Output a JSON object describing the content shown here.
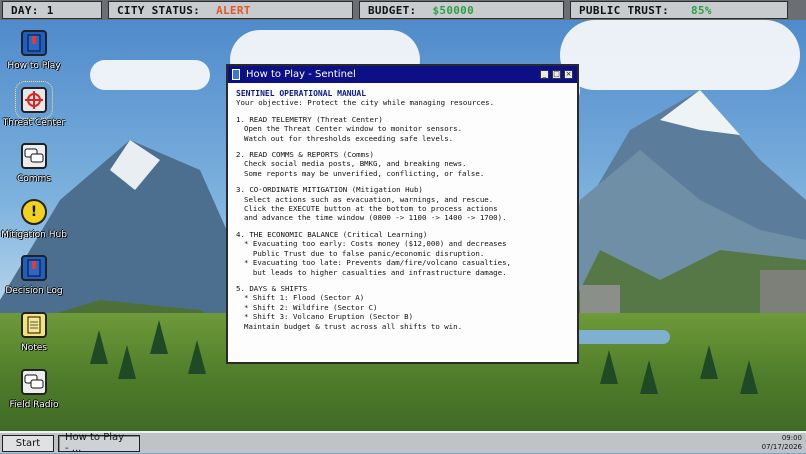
{
  "status_bar": {
    "day": {
      "label": "DAY:",
      "value": "1"
    },
    "city_status": {
      "label": "CITY STATUS:",
      "value": "ALERT"
    },
    "budget": {
      "label": "BUDGET:",
      "value": "$50000"
    },
    "public_trust": {
      "label": "PUBLIC TRUST:",
      "value": "85%"
    }
  },
  "desktop_icons": [
    {
      "label": "How to Play",
      "icon": "book-icon"
    },
    {
      "label": "Threat Center",
      "icon": "crosshair-icon"
    },
    {
      "label": "Comms",
      "icon": "chat-bubbles-icon"
    },
    {
      "label": "Mitigation Hub",
      "icon": "warning-icon"
    },
    {
      "label": "Decision Log",
      "icon": "book-icon"
    },
    {
      "label": "Notes",
      "icon": "notepad-icon"
    },
    {
      "label": "Field Radio",
      "icon": "chat-bubbles-icon"
    }
  ],
  "window": {
    "title": "How to Play - Sentinel",
    "heading": "SENTINEL OPERATIONAL MANUAL",
    "intro": "Your objective: Protect the city while managing resources.",
    "sections": [
      {
        "title": "1. READ TELEMETRY (Threat Center)",
        "lines": [
          "Open the Threat Center window to monitor sensors.",
          "Watch out for thresholds exceeding safe levels."
        ]
      },
      {
        "title": "2. READ COMMS & REPORTS (Comms)",
        "lines": [
          "Check social media posts, BMKG, and breaking news.",
          "Some reports may be unverified, conflicting, or false."
        ]
      },
      {
        "title": "3. CO-ORDINATE MITIGATION (Mitigation Hub)",
        "lines": [
          "Select actions such as evacuation, warnings, and rescue.",
          "Click the EXECUTE button at the bottom to process actions",
          "and advance the time window (0800 -> 1100 -> 1400 -> 1700)."
        ]
      },
      {
        "title": "4. THE ECONOMIC BALANCE (Critical Learning)",
        "lines": [
          "* Evacuating too early: Costs money ($12,000) and decreases",
          "  Public Trust due to false panic/economic disruption.",
          "* Evacuating too late: Prevents dam/fire/volcano casualties,",
          "  but leads to higher casualties and infrastructure damage."
        ]
      },
      {
        "title": "5. DAYS & SHIFTS",
        "lines": [
          "* Shift 1: Flood (Sector A)",
          "* Shift 2: Wildfire (Sector C)",
          "* Shift 3: Volcano Eruption (Sector B)",
          "Maintain budget & trust across all shifts to win."
        ]
      }
    ]
  },
  "taskbar": {
    "start_label": "Start",
    "task_label": "How to Play - ...",
    "time": "09:00",
    "date": "07/17/2026"
  },
  "colors": {
    "title_bar": "#0c0f86",
    "alert": "#e2572a",
    "trust": "#2ea043"
  }
}
